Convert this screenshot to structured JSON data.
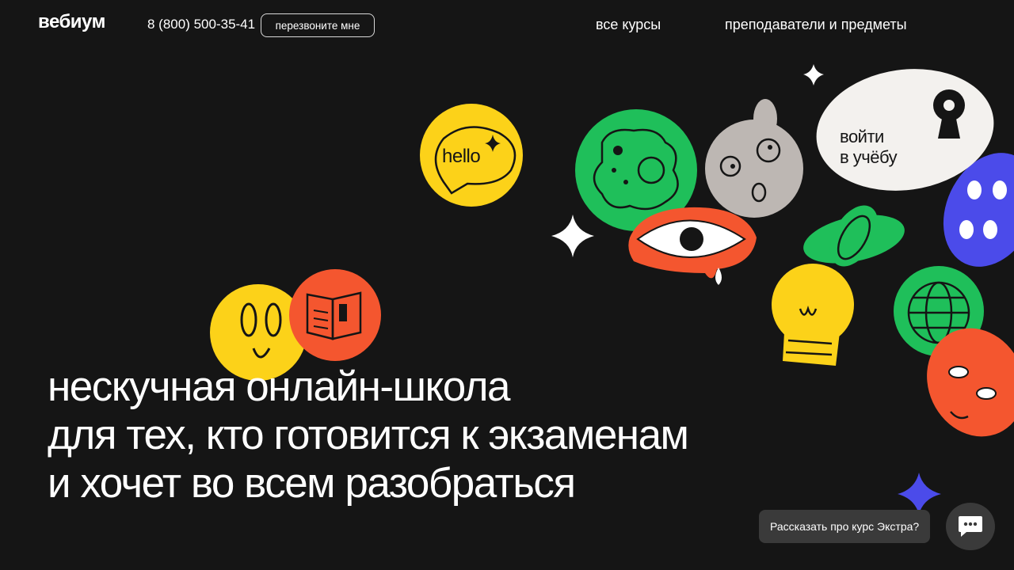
{
  "header": {
    "logo": "вебиум",
    "phone": "8 (800) 500-35-41",
    "callback_label": "перезвоните мне",
    "nav": {
      "courses": "все курсы",
      "teachers": "преподаватели и предметы"
    }
  },
  "hero": {
    "lines": [
      "нескучная онлайн-школа",
      "для тех, кто готовится к экзаменам",
      "и хочет во всем разобраться"
    ]
  },
  "stickers": {
    "hello_text": "hello",
    "login_line1": "войти",
    "login_line2": "в учёбу"
  },
  "chat": {
    "prompt": "Рассказать про курс Экстра?"
  },
  "colors": {
    "background": "#151515",
    "yellow": "#fcd219",
    "green": "#1fbf5a",
    "orange": "#f4562f",
    "blue": "#4b4bea",
    "gray": "#bdb7b3",
    "cream": "#f3f1ee"
  },
  "icons": [
    "sparkle-icon",
    "chat-icon",
    "keyhole-icon"
  ]
}
